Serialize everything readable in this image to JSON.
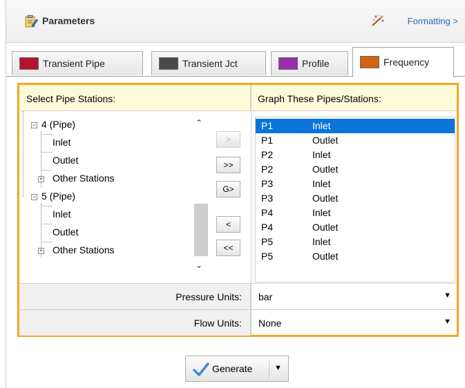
{
  "header": {
    "title": "Parameters",
    "formatting_link": "Formatting >",
    "icon": "clipboard-edit-icon",
    "formatting_icon": "magic-wand-icon"
  },
  "tabs": [
    {
      "label": "Transient Pipe",
      "icon_color": "#b5122e",
      "active": false
    },
    {
      "label": "Transient Jct",
      "icon_color": "#4a4a4a",
      "active": false
    },
    {
      "label": "Profile",
      "icon_color": "#9b2cb0",
      "active": false
    },
    {
      "label": "Frequency",
      "icon_color": "#d4640f",
      "active": true
    }
  ],
  "accent_color": "#f5a623",
  "select_header": "Select Pipe Stations:",
  "graph_header": "Graph These Pipes/Stations:",
  "tree": [
    {
      "label": "4 (Pipe)",
      "expanded": true
    },
    {
      "label": "Inlet"
    },
    {
      "label": "Outlet"
    },
    {
      "label": "Other Stations",
      "expanded": false
    },
    {
      "label": "5 (Pipe)",
      "expanded": true
    },
    {
      "label": "Inlet"
    },
    {
      "label": "Outlet"
    },
    {
      "label": "Other Stations",
      "expanded": false
    }
  ],
  "move_buttons": {
    "add": ">",
    "add_all": ">>",
    "add_group": "G>",
    "remove": "<",
    "remove_all": "<<"
  },
  "graph_list": [
    {
      "pipe": "P1",
      "station": "Inlet",
      "selected": true
    },
    {
      "pipe": "P1",
      "station": "Outlet"
    },
    {
      "pipe": "P2",
      "station": "Inlet"
    },
    {
      "pipe": "P2",
      "station": "Outlet"
    },
    {
      "pipe": "P3",
      "station": "Inlet"
    },
    {
      "pipe": "P3",
      "station": "Outlet"
    },
    {
      "pipe": "P4",
      "station": "Inlet"
    },
    {
      "pipe": "P4",
      "station": "Outlet"
    },
    {
      "pipe": "P5",
      "station": "Inlet"
    },
    {
      "pipe": "P5",
      "station": "Outlet"
    }
  ],
  "units": {
    "pressure_label": "Pressure Units:",
    "pressure_value": "bar",
    "flow_label": "Flow Units:",
    "flow_value": "None"
  },
  "generate": {
    "label": "Generate"
  }
}
